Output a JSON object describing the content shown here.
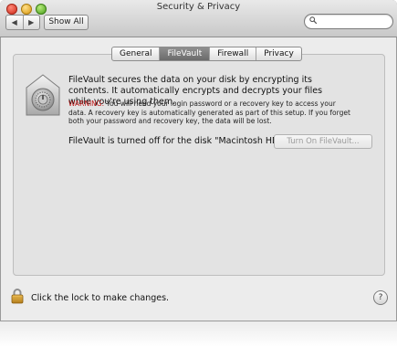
{
  "window": {
    "title": "Security & Privacy"
  },
  "toolbar": {
    "back_glyph": "◀",
    "forward_glyph": "▶",
    "show_all_label": "Show All",
    "search_placeholder": "",
    "search_icon": "magnifying-glass-icon"
  },
  "tabs": [
    {
      "label": "General",
      "selected": false
    },
    {
      "label": "FileVault",
      "selected": true
    },
    {
      "label": "Firewall",
      "selected": false
    },
    {
      "label": "Privacy",
      "selected": false
    }
  ],
  "filevault": {
    "icon": "filevault-safe-icon",
    "description": "FileVault secures the data on your disk by encrypting its contents. It automatically encrypts and decrypts your files while you're using them.",
    "warning_label": "WARNING:",
    "warning_text": " You will need your login password or a recovery key to access your data. A recovery key is automatically generated as part of this setup. If you forget both your password and recovery key, the data will be lost.",
    "status": "FileVault is turned off for the disk \"Macintosh HD\".",
    "turn_on_label": "Turn On FileVault..."
  },
  "footer": {
    "lock_icon": "padlock-icon",
    "lock_hint": "Click the lock to make changes.",
    "help_label": "?"
  },
  "colors": {
    "active_tab": "#7a7a7a",
    "warning": "#c01818",
    "window_bg": "#ececec"
  }
}
